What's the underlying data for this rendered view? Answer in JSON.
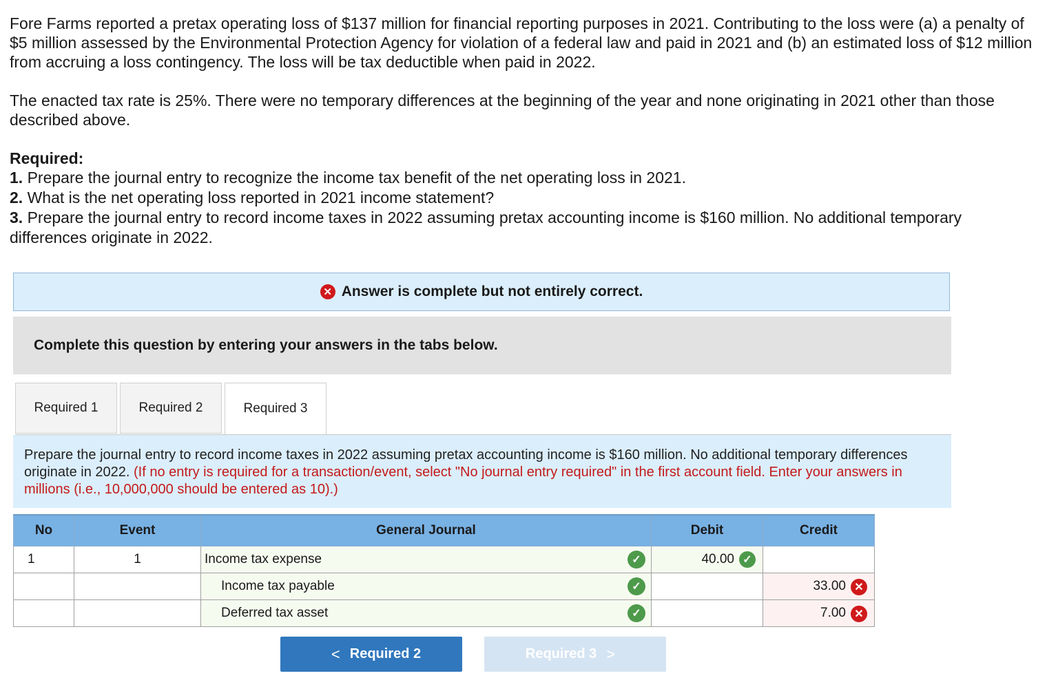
{
  "problem": {
    "paragraph1": "Fore Farms reported a pretax operating loss of $137 million for financial reporting purposes in 2021. Contributing to the loss were (a) a penalty of $5 million assessed by the Environmental Protection Agency for violation of a federal law and paid in 2021 and (b) an estimated loss of $12 million from accruing a loss contingency. The loss will be tax deductible when paid in 2022.",
    "paragraph2": "The enacted tax rate is 25%. There were no temporary differences at the beginning of the year and none originating in 2021 other than those described above.",
    "required_heading": "Required:",
    "items": [
      {
        "num": "1.",
        "text": " Prepare the journal entry to recognize the income tax benefit of the net operating loss in 2021."
      },
      {
        "num": "2.",
        "text": " What is the net operating loss reported in 2021 income statement?"
      },
      {
        "num": "3.",
        "text": " Prepare the journal entry to record income taxes in 2022 assuming pretax accounting income is $160 million. No additional temporary differences originate in 2022."
      }
    ]
  },
  "banner": {
    "text": "Answer is complete but not entirely correct."
  },
  "instruction": "Complete this question by entering your answers in the tabs below.",
  "tabs": [
    {
      "label": "Required 1",
      "active": false
    },
    {
      "label": "Required 2",
      "active": false
    },
    {
      "label": "Required 3",
      "active": true
    }
  ],
  "question": {
    "text": "Prepare the journal entry to record income taxes in 2022 assuming pretax accounting income is $160 million. No additional temporary differences originate in 2022.",
    "note": "(If no entry is required for a transaction/event, select \"No journal entry required\" in the first account field. Enter your answers in millions (i.e., 10,000,000 should be entered as 10).)"
  },
  "journal": {
    "headers": {
      "no": "No",
      "event": "Event",
      "account": "General Journal",
      "debit": "Debit",
      "credit": "Credit"
    },
    "rows": [
      {
        "no": "1",
        "event": "1",
        "account": "Income tax expense",
        "debit": "40.00",
        "credit": "",
        "debit_status": "correct",
        "credit_status": ""
      },
      {
        "no": "",
        "event": "",
        "account": "Income tax payable",
        "debit": "",
        "credit": "33.00",
        "debit_status": "",
        "credit_status": "incorrect"
      },
      {
        "no": "",
        "event": "",
        "account": "Deferred tax asset",
        "debit": "",
        "credit": "7.00",
        "debit_status": "",
        "credit_status": "incorrect"
      }
    ]
  },
  "nav": {
    "prev_label": "Required 2",
    "next_label": "Required 3"
  },
  "colors": {
    "accent": "#3077bd",
    "correct": "#4d9a4b",
    "incorrect": "#d0191b",
    "header": "#78b1e3"
  }
}
